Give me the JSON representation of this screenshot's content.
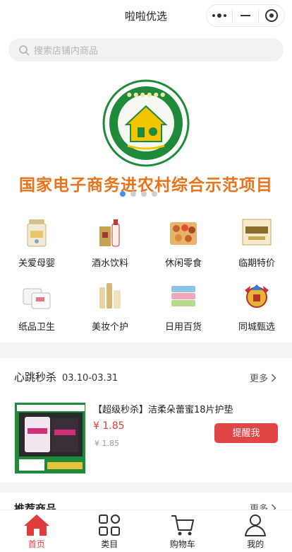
{
  "app": {
    "title": "啦啦优选"
  },
  "search": {
    "placeholder": "搜索店铺内商品"
  },
  "banner": {
    "title": "国家电子商务进农村综合示范项目",
    "slides": 4,
    "active_slide": 1
  },
  "categories": [
    {
      "label": "关爱母婴",
      "icon": "baby-formula-icon"
    },
    {
      "label": "酒水饮料",
      "icon": "liquor-bottle-icon"
    },
    {
      "label": "休闲零食",
      "icon": "snack-box-icon"
    },
    {
      "label": "临期特价",
      "icon": "outlets-sign-icon"
    },
    {
      "label": "纸品卫生",
      "icon": "tissue-pack-icon"
    },
    {
      "label": "美妆个护",
      "icon": "cosmetics-icon"
    },
    {
      "label": "日用百货",
      "icon": "towel-stack-icon"
    },
    {
      "label": "同城甄选",
      "icon": "city-badge-icon"
    }
  ],
  "flash_sale": {
    "title": "心跳秒杀",
    "date_range": "03.10-03.31",
    "more_label": "更多",
    "product": {
      "name": "【超级秒杀】洁柔朵蕾蜜18片护垫",
      "price": "¥ 1.85",
      "original_price": "¥ 1.85",
      "button_label": "提醒我"
    }
  },
  "recommended": {
    "title": "推荐商品",
    "more_label": "更多"
  },
  "tabbar": [
    {
      "label": "首页",
      "icon": "home-icon",
      "active": true
    },
    {
      "label": "类目",
      "icon": "category-grid-icon",
      "active": false
    },
    {
      "label": "购物车",
      "icon": "cart-icon",
      "active": false
    },
    {
      "label": "我的",
      "icon": "user-icon",
      "active": false
    }
  ],
  "colors": {
    "accent": "#e03c3c",
    "banner_text": "#e8731a",
    "badge_green": "#1f8a3a",
    "indicator_active": "#4a90e2"
  }
}
